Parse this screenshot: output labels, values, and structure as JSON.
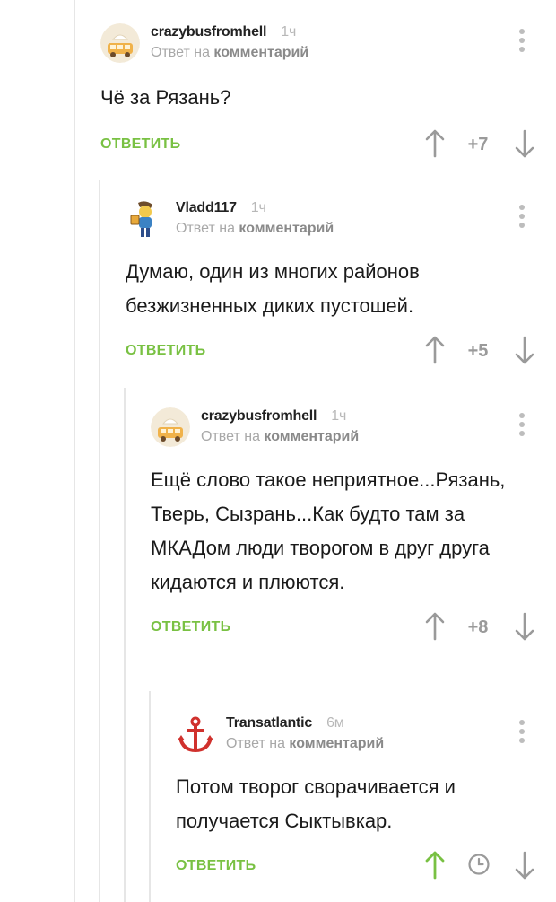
{
  "comments": [
    {
      "author": "crazybusfromhell",
      "time": "1ч",
      "reply_prefix": "Ответ на",
      "reply_target": "комментарий",
      "text": "Чё за Рязань?",
      "reply_label": "ОТВЕТИТЬ",
      "rating": "+7",
      "avatar": "bus-avatar"
    },
    {
      "author": "Vladd117",
      "time": "1ч",
      "reply_prefix": "Ответ на",
      "reply_target": "комментарий",
      "text": "Думаю, один из многих районов безжизненных диких пустошей.",
      "reply_label": "ОТВЕТИТЬ",
      "rating": "+5",
      "avatar": "character-avatar"
    },
    {
      "author": "crazybusfromhell",
      "time": "1ч",
      "reply_prefix": "Ответ на",
      "reply_target": "комментарий",
      "text": "Ещё слово такое неприятное...Рязань, Тверь, Сызрань...Как будто там за МКАДом люди творогом в друг друга кидаются и плюются.",
      "reply_label": "ОТВЕТИТЬ",
      "rating": "+8",
      "avatar": "bus-avatar"
    },
    {
      "author": "Transatlantic",
      "time": "6м",
      "reply_prefix": "Ответ на",
      "reply_target": "комментарий",
      "text": "Потом творог сворачивается и получается Сыктывкар.",
      "reply_label": "ОТВЕТИТЬ",
      "rating_icon": "clock-icon",
      "avatar": "anchor-avatar"
    }
  ],
  "colors": {
    "accent_green": "#79c143",
    "anchor_red": "#d0312d",
    "muted": "#a8a8a8"
  }
}
